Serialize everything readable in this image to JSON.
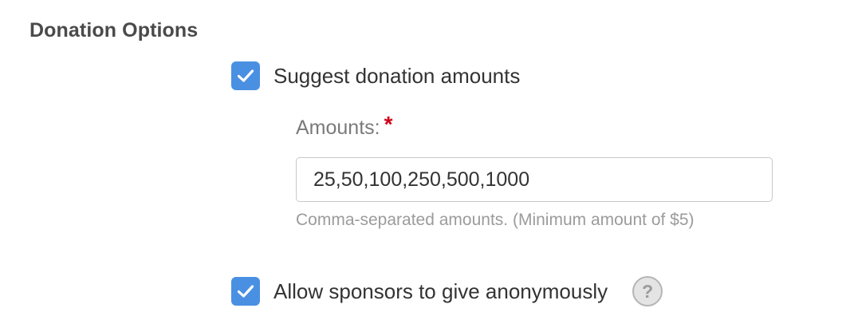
{
  "section": {
    "title": "Donation Options"
  },
  "suggest_option": {
    "checked": true,
    "label": "Suggest donation amounts"
  },
  "amounts_field": {
    "label": "Amounts:",
    "required_marker": "*",
    "value": "25,50,100,250,500,1000",
    "help": "Comma-separated amounts. (Minimum amount of $5)"
  },
  "anonymous_option": {
    "checked": true,
    "label": "Allow sponsors to give anonymously",
    "help_icon": "?"
  },
  "colors": {
    "checkbox_accent": "#4a90e2",
    "required_star": "#d0021b",
    "help_text": "#9b9b9b"
  },
  "icons": {
    "checkbox": "check-icon",
    "help": "question-circle-icon"
  }
}
